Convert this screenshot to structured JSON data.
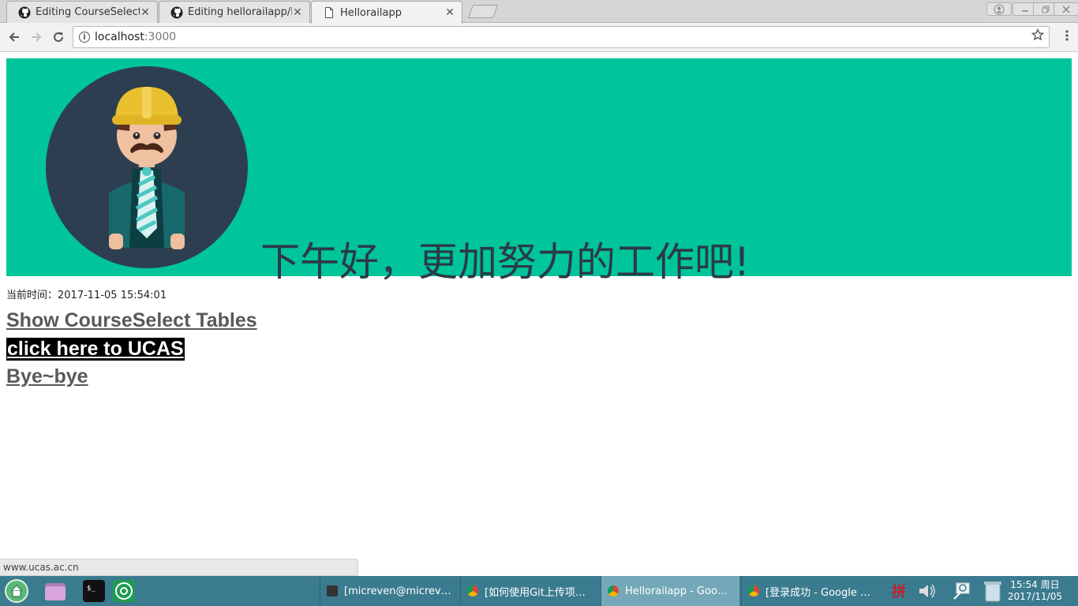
{
  "browser": {
    "tabs": [
      {
        "title": "Editing CourseSelect/R",
        "icon": "github-icon"
      },
      {
        "title": "Editing hellorailapp/RE",
        "icon": "github-icon"
      },
      {
        "title": "Hellorailapp",
        "icon": "page-icon",
        "active": true
      }
    ],
    "close_glyph": "✕",
    "url_host": "localhost",
    "url_port": ":3000"
  },
  "page": {
    "greeting": "下午好，更加努力的工作吧!",
    "current_time_label": "当前时间：",
    "current_time": "2017-11-05 15:54:01",
    "links": [
      {
        "label": "Show CourseSelect Tables"
      },
      {
        "label": "click here to UCAS",
        "highlighted": true
      },
      {
        "label": "Bye~bye"
      }
    ],
    "banner_color": "#00c49a"
  },
  "status_bar": {
    "text": "www.ucas.ac.cn"
  },
  "taskbar": {
    "items": [
      {
        "label": "[micreven@micreven...",
        "icon": "terminal-icon"
      },
      {
        "label": "[如何使用Git上传项目...",
        "icon": "chrome-icon"
      },
      {
        "label": "Hellorailapp - Google...",
        "icon": "chrome-icon",
        "active": true
      },
      {
        "label": "[登录成功 - Google Ch...",
        "icon": "chrome-icon"
      }
    ],
    "ime": "拼",
    "clock_time": "15:54 周日",
    "clock_date": "2017/11/05"
  }
}
